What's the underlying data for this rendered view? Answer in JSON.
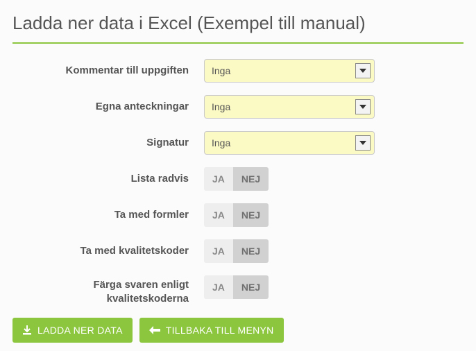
{
  "page_title": "Ladda ner data i Excel (Exempel till manual)",
  "toggles": {
    "yes": "JA",
    "no": "NEJ"
  },
  "fields": {
    "comment": {
      "label": "Kommentar till uppgiften",
      "value": "Inga"
    },
    "notes": {
      "label": "Egna anteckningar",
      "value": "Inga"
    },
    "signature": {
      "label": "Signatur",
      "value": "Inga"
    },
    "list_row": {
      "label": "Lista radvis",
      "selected": "NEJ"
    },
    "formulas": {
      "label": "Ta med formler",
      "selected": "NEJ"
    },
    "quality_codes": {
      "label": "Ta med kvalitetskoder",
      "selected": "NEJ"
    },
    "color_answers": {
      "label": "Färga svaren enligt kvalitetskoderna",
      "selected": "NEJ"
    }
  },
  "actions": {
    "download": "LADDA NER DATA",
    "back": "TILLBAKA TILL MENYN"
  }
}
